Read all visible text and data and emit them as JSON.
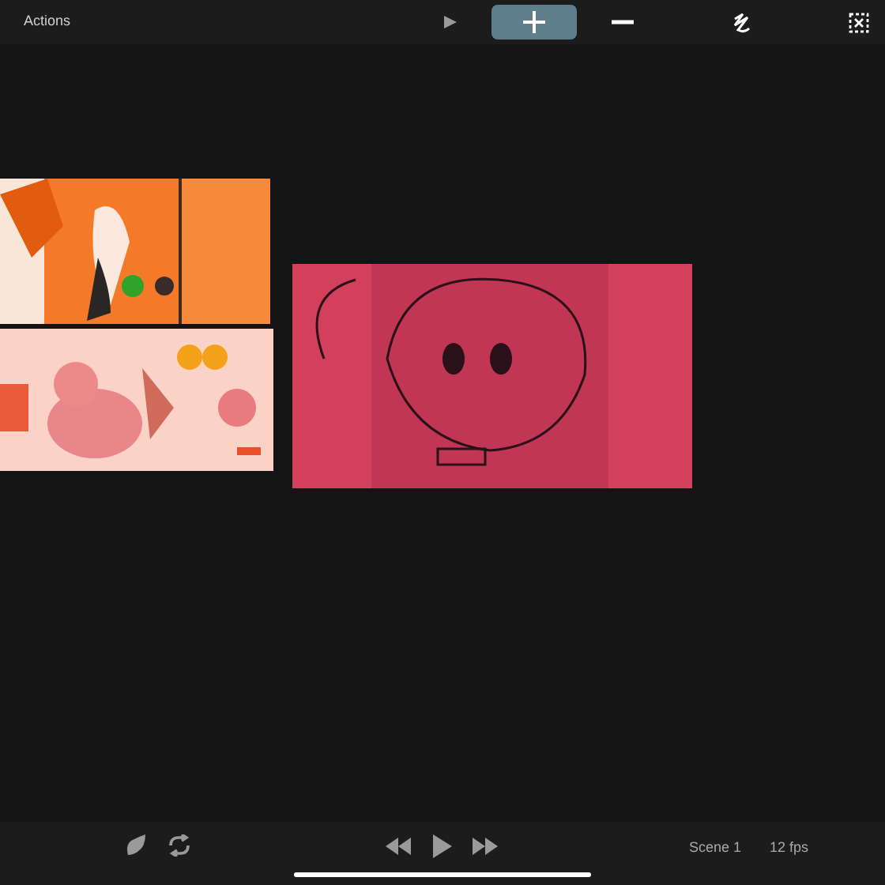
{
  "toolbar": {
    "title": "Actions",
    "tools": [
      {
        "kind": "play",
        "selected": false
      },
      {
        "kind": "add",
        "selected": true
      },
      {
        "kind": "remove",
        "selected": false
      },
      {
        "kind": "draw",
        "selected": false
      },
      {
        "kind": "clear",
        "selected": false
      }
    ]
  },
  "transport": {
    "scene": "Scene 1",
    "fps": "12 fps"
  }
}
